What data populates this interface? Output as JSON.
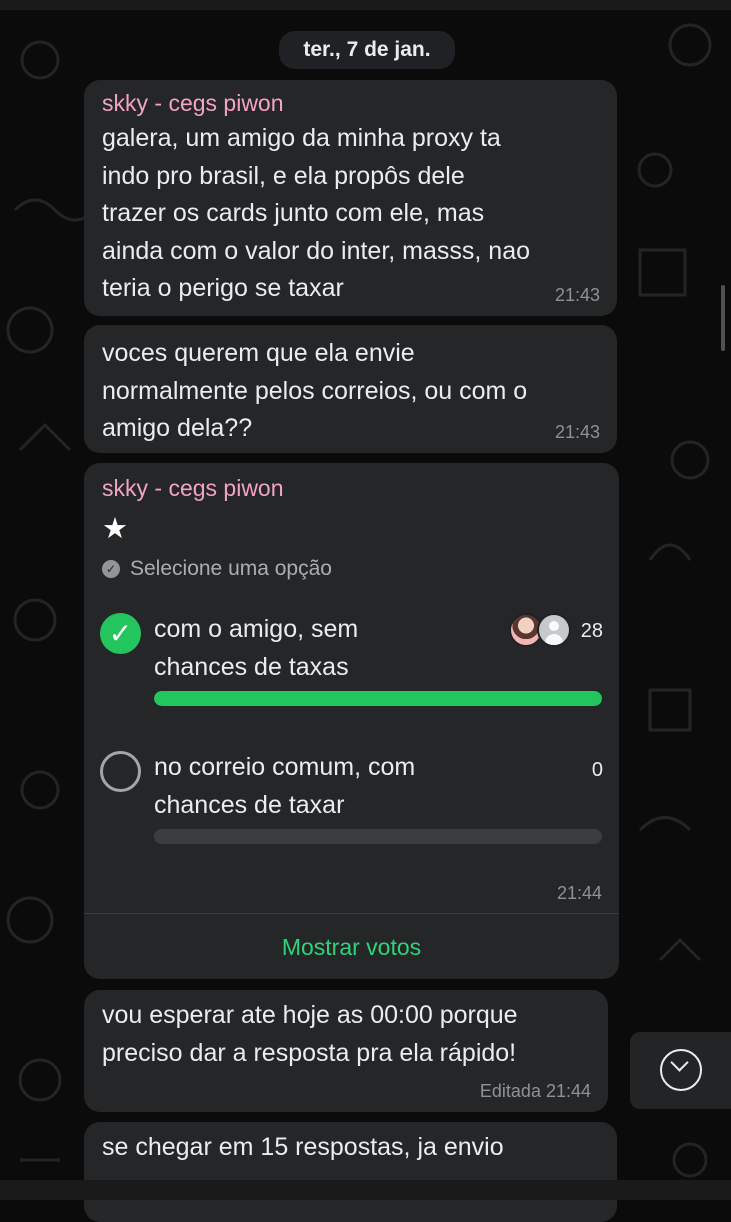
{
  "date_label": "ter., 7 de jan.",
  "messages": [
    {
      "sender": "skky - cegs piwon",
      "text": "galera, um amigo da minha proxy ta\nindo pro brasil, e ela propôs dele\ntrazer os cards junto com ele, mas\nainda com o valor do inter, masss, nao\nteria o perigo se taxar",
      "time": "21:43"
    },
    {
      "text": "voces querem que ela envie\nnormalmente pelos correios, ou com o\namigo dela??",
      "time": "21:43"
    },
    {
      "sender": "skky - cegs piwon",
      "poll": {
        "question": "★",
        "hint": "Selecione uma opção",
        "options": [
          {
            "text": "com o amigo, sem\nchances de taxas",
            "count": "28",
            "fraction": 1,
            "selected": true
          },
          {
            "text": "no correio comum, com\nchances de taxar",
            "count": "0",
            "fraction": 0,
            "selected": false
          }
        ],
        "time": "21:44",
        "show_votes_label": "Mostrar votos"
      }
    },
    {
      "text": "vou esperar ate hoje as 00:00 porque\npreciso dar a resposta pra ela rápido!",
      "time": "Editada 21:44"
    },
    {
      "text": "se chegar em 15 respostas, ja envio"
    }
  ],
  "icons": {
    "check": "✓",
    "scroll_down": "chevron-down-icon"
  }
}
